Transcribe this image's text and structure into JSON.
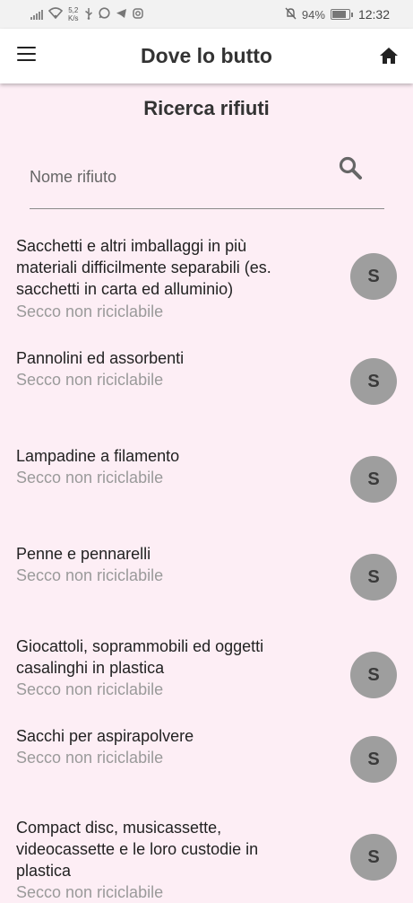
{
  "status_bar": {
    "net_speed_value": "5,2",
    "net_speed_unit": "K/s",
    "battery": "94%",
    "battery_level": 0.94,
    "time": "12:32",
    "icons": [
      "signal-icon",
      "wifi-icon",
      "usb-icon",
      "whatsapp-icon",
      "telegram-icon",
      "instagram-icon",
      "mute-alarm-icon",
      "battery-icon"
    ]
  },
  "app_bar": {
    "title": "Dove lo butto",
    "menu_icon": "hamburger-menu-icon",
    "home_icon": "home-icon"
  },
  "page": {
    "title": "Ricerca rifiuti"
  },
  "search": {
    "placeholder": "Nome rifiuto",
    "value": "",
    "icon": "search-icon"
  },
  "colors": {
    "background": "#fdeef5",
    "avatar": "#9e9e9e",
    "category_text": "#9a9a9a"
  },
  "results": [
    {
      "name_lines": [
        "Sacchetti e altri imballaggi in più",
        "materiali difficilmente separabili (es.",
        "sacchetti in carta ed alluminio)"
      ],
      "category": "Secco non riciclabile",
      "badge": "S"
    },
    {
      "name_lines": [
        "Pannolini ed assorbenti"
      ],
      "category": "Secco non riciclabile",
      "badge": "S"
    },
    {
      "name_lines": [
        "Lampadine a filamento"
      ],
      "category": "Secco non riciclabile",
      "badge": "S"
    },
    {
      "name_lines": [
        "Penne e pennarelli"
      ],
      "category": "Secco non riciclabile",
      "badge": "S"
    },
    {
      "name_lines": [
        "Giocattoli, soprammobili ed oggetti",
        "casalinghi in plastica"
      ],
      "category": "Secco non riciclabile",
      "badge": "S"
    },
    {
      "name_lines": [
        "Sacchi per aspirapolvere"
      ],
      "category": "Secco non riciclabile",
      "badge": "S"
    },
    {
      "name_lines": [
        "Compact disc, musicassette,",
        "videocassette e le loro custodie in",
        "plastica"
      ],
      "category": "Secco non riciclabile",
      "badge": "S"
    }
  ]
}
